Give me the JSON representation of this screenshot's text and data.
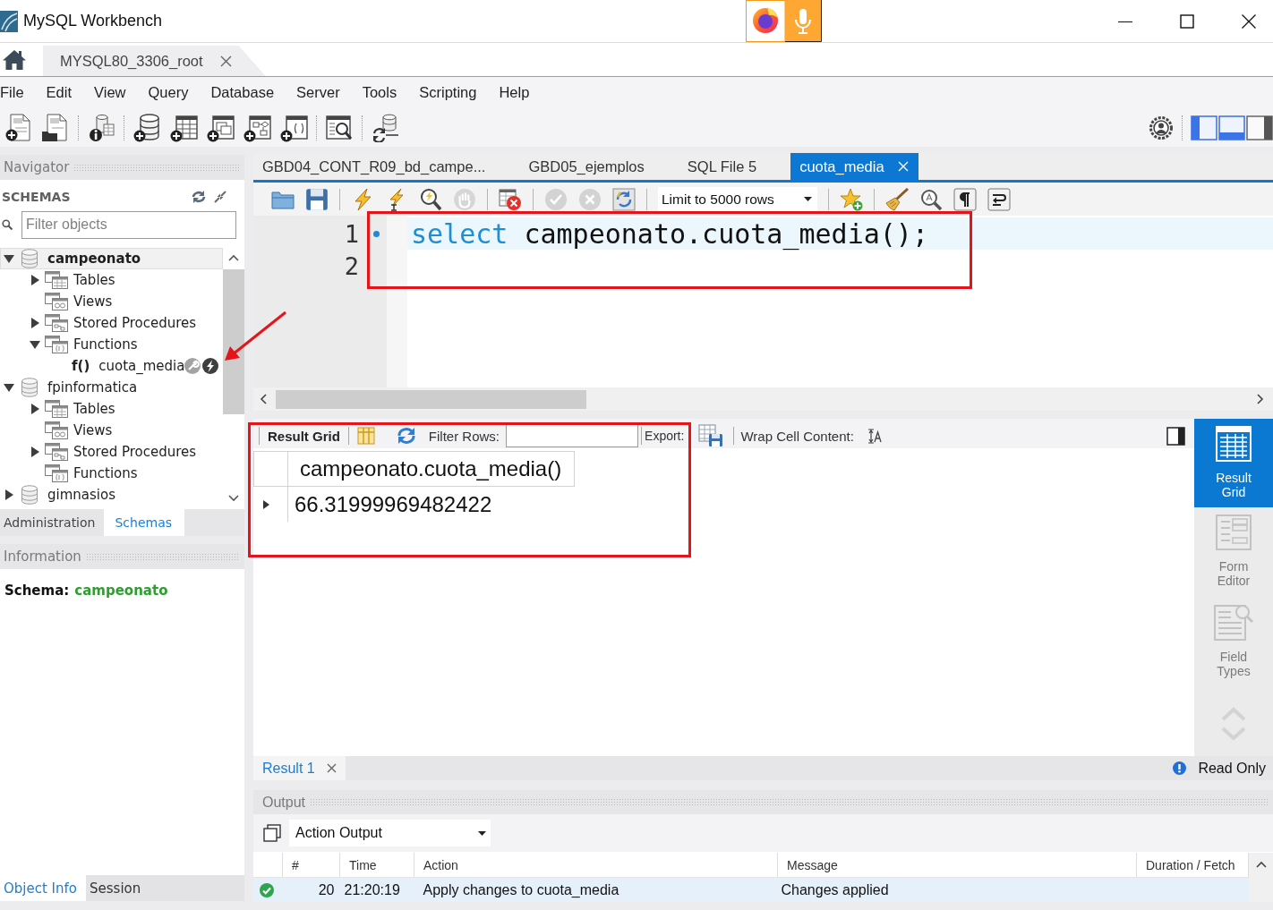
{
  "window": {
    "title": "MySQL Workbench"
  },
  "connection_tabs": [
    {
      "label": "MYSQL80_3306_root",
      "selected": true
    }
  ],
  "menu": [
    "File",
    "Edit",
    "View",
    "Query",
    "Database",
    "Server",
    "Tools",
    "Scripting",
    "Help"
  ],
  "layout_toggles": [
    {
      "kind": "sidebar",
      "on": true
    },
    {
      "kind": "output",
      "on": true
    },
    {
      "kind": "secondary",
      "on": false
    }
  ],
  "navigator": {
    "title": "Navigator",
    "section": "SCHEMAS",
    "filter": {
      "placeholder": "Filter objects"
    },
    "tree": [
      {
        "label": "campeonato",
        "kind": "schema",
        "expanded": true,
        "selected": true,
        "default": true,
        "hovered": false,
        "children": [
          {
            "label": "Tables",
            "kind": "tables",
            "expanded": false,
            "selected": false,
            "default": false,
            "hovered": false
          },
          {
            "label": "Views",
            "kind": "views",
            "selected": false,
            "default": false,
            "hovered": false
          },
          {
            "label": "Stored Procedures",
            "kind": "procedures",
            "expanded": false,
            "selected": false,
            "default": false,
            "hovered": false
          },
          {
            "label": "Functions",
            "kind": "functions",
            "expanded": true,
            "selected": false,
            "default": false,
            "hovered": false,
            "children": [
              {
                "label": "cuota_media",
                "kind": "function",
                "prefix": "f()",
                "selected": false,
                "default": false,
                "hovered": true
              }
            ]
          }
        ]
      },
      {
        "label": "fpinformatica",
        "kind": "schema",
        "expanded": true,
        "selected": false,
        "default": false,
        "hovered": false,
        "children": [
          {
            "label": "Tables",
            "kind": "tables",
            "expanded": false,
            "selected": false,
            "default": false,
            "hovered": false
          },
          {
            "label": "Views",
            "kind": "views",
            "selected": false,
            "default": false,
            "hovered": false
          },
          {
            "label": "Stored Procedures",
            "kind": "procedures",
            "expanded": false,
            "selected": false,
            "default": false,
            "hovered": false
          },
          {
            "label": "Functions",
            "kind": "functions",
            "selected": false,
            "default": false,
            "hovered": false
          }
        ]
      },
      {
        "label": "gimnasios",
        "kind": "schema",
        "expanded": false,
        "selected": false,
        "default": false,
        "hovered": false
      }
    ]
  },
  "navigator_tabs": [
    {
      "label": "Administration",
      "selected": false
    },
    {
      "label": "Schemas",
      "selected": true
    }
  ],
  "information": {
    "title": "Information",
    "schema_label": "Schema:",
    "schema_name": "campeonato"
  },
  "info_tabs": [
    {
      "label": "Object Info",
      "selected": true
    },
    {
      "label": "Session",
      "selected": false
    }
  ],
  "editor_tabs": [
    {
      "label": "GBD04_CONT_R09_bd_campe...",
      "selected": false
    },
    {
      "label": "GBD05_ejemplos",
      "selected": false
    },
    {
      "label": "SQL File 5",
      "selected": false
    },
    {
      "label": "cuota_media",
      "selected": true
    }
  ],
  "editor_toolbar": {
    "limit": "Limit to 5000 rows"
  },
  "editor": {
    "lines": [
      {
        "number": "1",
        "current": true,
        "marker": true,
        "tokens": [
          {
            "kind": "keyword",
            "text": "select"
          },
          {
            "kind": "plain",
            "text": " campeonato.cuota_media();"
          }
        ]
      },
      {
        "number": "2",
        "current": false,
        "marker": false
      }
    ]
  },
  "result_toolbar": {
    "view_label": "Result Grid",
    "filter_label": "Filter Rows:",
    "export_label": "Export:",
    "wrap_label": "Wrap Cell Content:"
  },
  "result_grid": {
    "columns": [
      "campeonato.cuota_media()"
    ],
    "rows": [
      {
        "current": true,
        "cells": [
          "66.31999969482422"
        ]
      }
    ]
  },
  "result_views": [
    {
      "kind": "grid",
      "label": "Result Grid",
      "selected": true
    },
    {
      "kind": "form",
      "label": "Form Editor",
      "selected": false
    },
    {
      "kind": "types",
      "label": "Field Types",
      "selected": false
    }
  ],
  "result_tabs": [
    {
      "label": "Result 1",
      "selected": true
    }
  ],
  "result_status": "Read Only",
  "output": {
    "title": "Output",
    "selector": "Action Output",
    "columns": [
      "#",
      "Time",
      "Action",
      "Message",
      "Duration / Fetch"
    ],
    "rows": [
      {
        "success": true,
        "selected": true,
        "cells": [
          "20",
          "21:20:19",
          "Apply changes to cuota_media",
          "Changes applied"
        ]
      }
    ]
  }
}
